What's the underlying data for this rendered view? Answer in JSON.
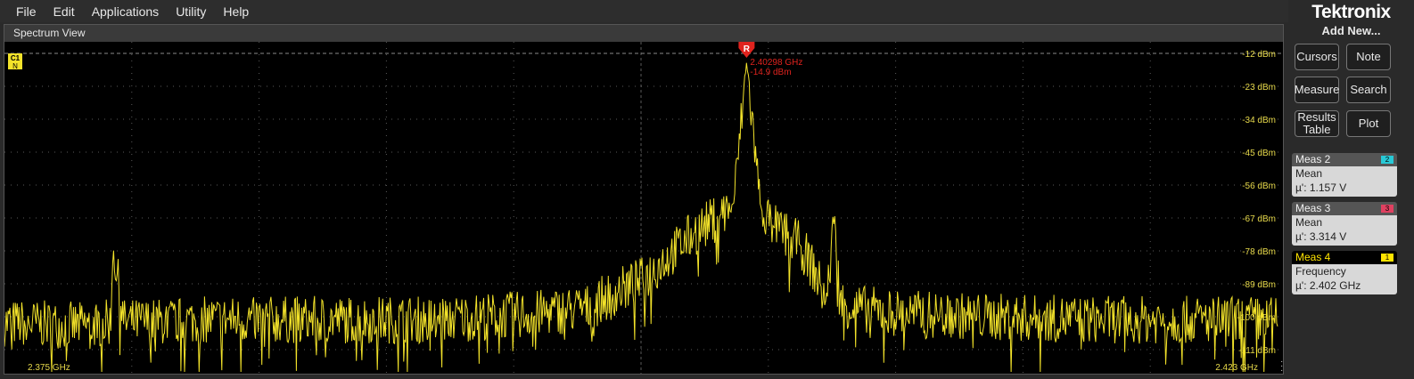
{
  "menu": [
    "File",
    "Edit",
    "Applications",
    "Utility",
    "Help"
  ],
  "panel_title": "Spectrum View",
  "channel_tag": {
    "label": "C1",
    "sub": "N"
  },
  "marker": {
    "letter": "R",
    "freq": "2.40298 GHz",
    "level": "-14.9 dBm"
  },
  "colors": {
    "trace": "#f2e22a",
    "marker": "#e0231e",
    "axis_label": "#e6d84a",
    "grid": "#5a5a5a"
  },
  "chart_data": {
    "type": "line",
    "xlabel": "",
    "ylabel": "",
    "xlim": [
      2.375,
      2.423
    ],
    "x_start_label": "2.375 GHz",
    "x_end_label": "2.423 GHz",
    "ylim": [
      -115,
      -12
    ],
    "y_ticks": [
      -12,
      -23,
      -34,
      -45,
      -56,
      -67,
      -78,
      -89,
      -100,
      -111
    ],
    "y_tick_labels": [
      "-12 dBm",
      "-23 dBm",
      "-34 dBm",
      "-45 dBm",
      "-56 dBm",
      "-67 dBm",
      "-78 dBm",
      "-89 dBm",
      "-100 dBm",
      "-111 dBm"
    ],
    "grid": true,
    "series": [
      {
        "x": [
          2.375,
          2.378,
          2.379,
          2.3791,
          2.3795,
          2.383,
          2.387,
          2.391,
          2.395,
          2.397,
          2.398,
          2.399,
          2.4,
          2.401,
          2.402,
          2.4025,
          2.40298,
          2.4035,
          2.404,
          2.405,
          2.4055,
          2.406,
          2.4063,
          2.4065,
          2.407,
          2.409,
          2.412,
          2.416,
          2.42,
          2.423
        ],
        "y": [
          -102,
          -103,
          -102,
          -77,
          -102,
          -101,
          -101,
          -101,
          -99,
          -97,
          -92,
          -88,
          -80,
          -72,
          -66,
          -62,
          -14.9,
          -63,
          -70,
          -76,
          -84,
          -95,
          -66,
          -95,
          -97,
          -99,
          -100,
          -101,
          -101,
          -101
        ]
      }
    ]
  },
  "sidebar": {
    "logo": "Tektronix",
    "add_new": "Add New...",
    "buttons": [
      "Cursors",
      "Note",
      "Measure",
      "Search",
      "Results Table",
      "Plot"
    ],
    "measurements": [
      {
        "name": "Meas 2",
        "badge": "2",
        "badge_color": "#28c9d6",
        "type": "Mean",
        "value": "µ': 1.157 V",
        "active": false
      },
      {
        "name": "Meas 3",
        "badge": "3",
        "badge_color": "#e04060",
        "type": "Mean",
        "value": "µ': 3.314 V",
        "active": false
      },
      {
        "name": "Meas 4",
        "badge": "1",
        "badge_color": "#ffe400",
        "type": "Frequency",
        "value": "µ': 2.402 GHz",
        "active": true
      }
    ]
  }
}
